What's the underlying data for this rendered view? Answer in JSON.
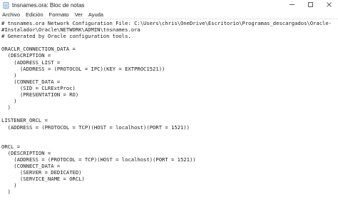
{
  "window": {
    "title": "tnsnames.ora: Bloc de notas",
    "app_icon": "notepad-icon",
    "controls": [
      "minimize-icon",
      "maximize-icon",
      "close-icon"
    ]
  },
  "menu": [
    {
      "label": "Archivo"
    },
    {
      "label": "Edición"
    },
    {
      "label": "Formato"
    },
    {
      "label": "Ver"
    },
    {
      "label": "Ayuda"
    }
  ],
  "document": {
    "lines": [
      "# tnsnames.ora Network Configuration File: C:\\Users\\chris\\OneDrive\\Escritorio\\Programas_descargados\\Oracle-",
      "#Instalador\\Oracle\\NETWORK\\ADMIN\\tnsnames.ora",
      "# Generated by Oracle configuration tools.",
      "",
      "ORACLR_CONNECTION_DATA =",
      "  (DESCRIPTION =",
      "    (ADDRESS_LIST =",
      "      (ADDRESS = (PROTOCOL = IPC)(KEY = EXTPROC1521))",
      "    )",
      "    (CONNECT_DATA =",
      "      (SID = CLRExtProc)",
      "      (PRESENTATION = RO)",
      "    )",
      "  )",
      "",
      "LISTENER_ORCL =",
      "  (ADDRESS = (PROTOCOL = TCP)(HOST = localhost)(PORT = 1521))",
      "",
      "",
      "ORCL =",
      "  (DESCRIPTION =",
      "    (ADDRESS = (PROTOCOL = TCP)(HOST = localhost)(PORT = 1521))",
      "    (CONNECT_DATA =",
      "      (SERVER = DEDICATED)",
      "      (SERVICE_NAME = ORCL)",
      "    )",
      "  )",
      ""
    ]
  }
}
